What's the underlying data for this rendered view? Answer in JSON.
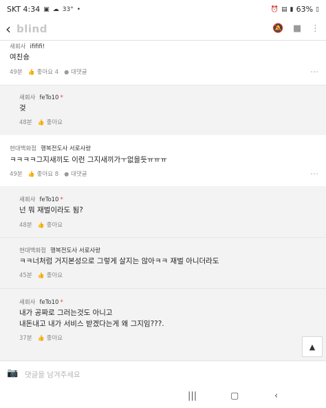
{
  "status": {
    "carrier_time": "SKT 4:34",
    "temp": "33°",
    "battery": "63%"
  },
  "header": {
    "logo": "blind"
  },
  "comments": [
    {
      "company": "새회사",
      "nick": "ifififi!",
      "star": "",
      "text": "여친숑",
      "time": "49분",
      "like": "좋아요 4",
      "reply": "대댓글"
    },
    {
      "company": "새회사",
      "nick": "feTo10",
      "star": "*",
      "text": "겆",
      "time": "48분",
      "like": "좋아요"
    },
    {
      "company": "현대백화점",
      "nick": "행복전도사 서로사랑",
      "star": "",
      "text": "ㅋㅋㅋㅋ그지새끼도 이런 그지새끼가ㅜ없을듯ㅠㅠㅠ",
      "time": "49분",
      "like": "좋아요 8",
      "reply": "대댓글"
    },
    {
      "company": "새회사",
      "nick": "feTo10",
      "star": "*",
      "text": "넌 뭐 재벌이라도 됨?",
      "time": "48분",
      "like": "좋아요"
    },
    {
      "company": "현대백화점",
      "nick": "행복전도사 서로사랑",
      "star": "",
      "text": "ㅋㅋ너처럼 거지본성으로 그렇게 살지는 않아ㅋㅋ 재벌 아니더라도",
      "time": "45분",
      "like": "좋아요"
    },
    {
      "company": "새회사",
      "nick": "feTo10",
      "star": "*",
      "text1": "내가 공짜로 그러는것도 아니고",
      "text2": "내돈내고 내가 서비스 받겠다는게 왜 그지임???.",
      "time": "37분",
      "like": "좋아요"
    }
  ],
  "input": {
    "placeholder": "댓글을 남겨주세요"
  }
}
